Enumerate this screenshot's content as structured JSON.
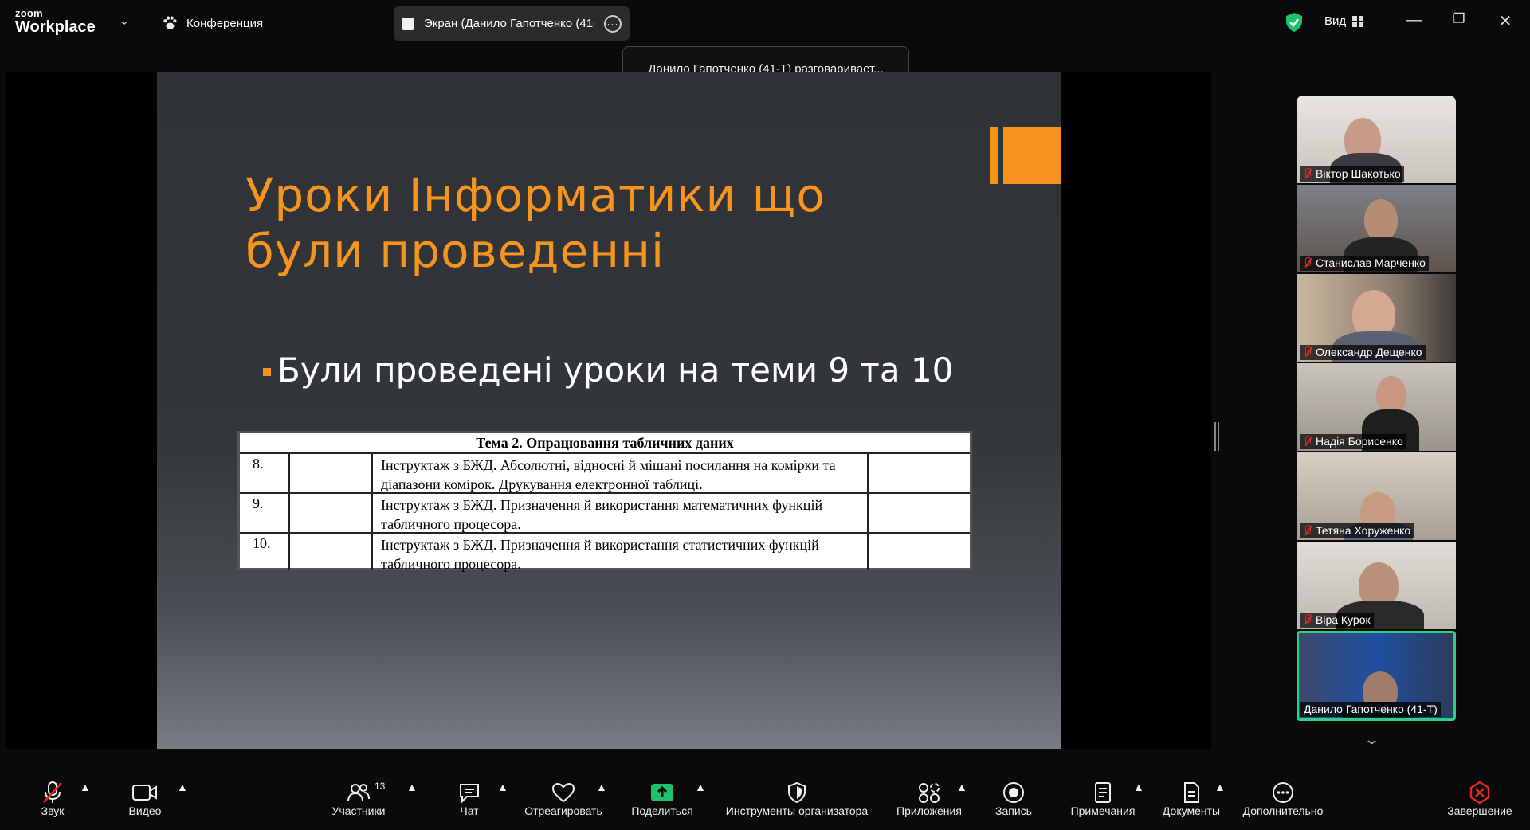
{
  "app": {
    "brand_top": "zoom",
    "brand_bottom": "Workplace"
  },
  "header": {
    "conference_label": "Конференция",
    "screen_label": "Экран (Данило Гапотченко (41-",
    "view_label": "Вид",
    "speaking_tooltip": "Данило Гапотченко (41-Т) разговаривает..."
  },
  "slide": {
    "title": "Уроки Інформатики що були проведенні",
    "bullet": "Були проведені уроки на теми 9 та 10",
    "accent_color": "#f7941d",
    "table": {
      "heading": "Тема 2. Опрацювання табличних даних",
      "rows": [
        {
          "num": "8.",
          "text": "Інструктаж з БЖД. Абсолютні, відносні й мішані посилання на комірки та діапазони комірок. Друкування електронної таблиці."
        },
        {
          "num": "9.",
          "text": "Інструктаж з БЖД. Призначення й використання математичних функцій табличного процесора."
        },
        {
          "num": "10.",
          "text": "Інструктаж з БЖД. Призначення й використання статистичних функцій табличного процесора."
        }
      ]
    }
  },
  "participants_strip": [
    {
      "name": "Віктор Шакотько",
      "muted": true
    },
    {
      "name": "Станислав Марченко",
      "muted": true
    },
    {
      "name": "Олександр Дещенко",
      "muted": true
    },
    {
      "name": "Надія Борисенко",
      "muted": true
    },
    {
      "name": "Тетяна Хоруженко",
      "muted": true
    },
    {
      "name": "Віра Курок",
      "muted": true
    },
    {
      "name": "Данило Гапотченко (41-Т)",
      "muted": false,
      "active": true
    }
  ],
  "toolbar": {
    "audio": "Звук",
    "video": "Видео",
    "participants": "Участники",
    "participants_count": "13",
    "chat": "Чат",
    "react": "Отреагировать",
    "share": "Поделиться",
    "host_tools": "Инструменты организатора",
    "apps": "Приложения",
    "record": "Запись",
    "notes": "Примечания",
    "docs": "Документы",
    "more": "Дополнительно",
    "end": "Завершение",
    "share_color": "#1fc16b",
    "end_color": "#e02828"
  }
}
